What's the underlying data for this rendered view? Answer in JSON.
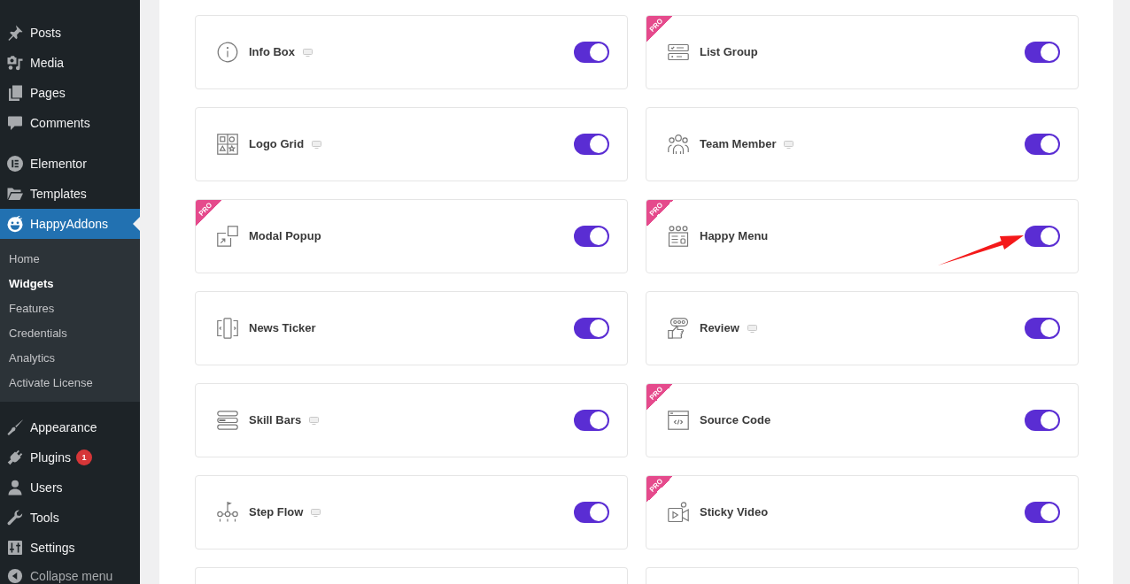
{
  "sidebar": {
    "groups": [
      {
        "items": [
          {
            "label": "Posts",
            "selected": false
          },
          {
            "label": "Media",
            "selected": false
          },
          {
            "label": "Pages",
            "selected": false
          },
          {
            "label": "Comments",
            "selected": false
          }
        ]
      },
      {
        "items": [
          {
            "label": "Elementor",
            "selected": false
          },
          {
            "label": "Templates",
            "selected": false
          },
          {
            "label": "HappyAddons",
            "selected": true,
            "expanded": true,
            "children": [
              {
                "label": "Home",
                "selected": false
              },
              {
                "label": "Widgets",
                "selected": true
              },
              {
                "label": "Features",
                "selected": false
              },
              {
                "label": "Credentials",
                "selected": false
              },
              {
                "label": "Analytics",
                "selected": false
              },
              {
                "label": "Activate License",
                "selected": false
              }
            ]
          }
        ]
      },
      {
        "items": [
          {
            "label": "Appearance",
            "selected": false
          },
          {
            "label": "Plugins",
            "selected": false,
            "badge": "1"
          },
          {
            "label": "Users",
            "selected": false
          },
          {
            "label": "Tools",
            "selected": false
          },
          {
            "label": "Settings",
            "selected": false
          }
        ]
      }
    ],
    "collapse_button": {
      "label": "Collapse menu"
    }
  },
  "widgets": [
    {
      "kind": "widget",
      "label": "Info Box",
      "preview": true,
      "on": true,
      "arrow": false
    },
    {
      "kind": "widget",
      "label": "List Group",
      "ribbon": "PRO",
      "preview": false,
      "on": true,
      "arrow": false
    },
    {
      "kind": "widget",
      "label": "Logo Grid",
      "preview": true,
      "on": true,
      "arrow": false
    },
    {
      "kind": "widget",
      "label": "Team Member",
      "preview": true,
      "on": true,
      "arrow": false
    },
    {
      "kind": "widget",
      "label": "Modal Popup",
      "ribbon": "PRO",
      "preview": false,
      "on": true,
      "arrow": false
    },
    {
      "kind": "widget",
      "label": "Happy Menu",
      "ribbon": "PRO",
      "preview": false,
      "on": true,
      "arrow": true
    },
    {
      "kind": "widget",
      "label": "News Ticker",
      "preview": false,
      "on": true,
      "arrow": false
    },
    {
      "kind": "widget",
      "label": "Review",
      "preview": true,
      "on": true,
      "arrow": false
    },
    {
      "kind": "widget",
      "label": "Skill Bars",
      "preview": true,
      "on": true,
      "arrow": false
    },
    {
      "kind": "widget",
      "label": "Source Code",
      "ribbon": "PRO",
      "preview": false,
      "on": true,
      "arrow": false
    },
    {
      "kind": "widget",
      "label": "Step Flow",
      "preview": true,
      "on": true,
      "arrow": false
    },
    {
      "kind": "widget",
      "label": "Sticky Video",
      "ribbon": "PRO",
      "preview": false,
      "on": true,
      "arrow": false
    },
    {
      "kind": "partial"
    },
    {
      "kind": "partial"
    }
  ]
}
